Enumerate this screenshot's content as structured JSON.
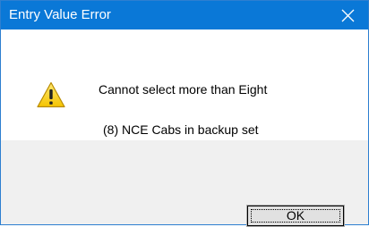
{
  "window": {
    "title": "Entry Value Error",
    "close_icon": "close-icon",
    "title_bar_color": "#0a78d7"
  },
  "message": {
    "icon": "warning-icon",
    "line1": "Cannot select more than Eight",
    "line2": "(8) NCE Cabs in backup set"
  },
  "buttons": {
    "ok_label": "OK"
  }
}
